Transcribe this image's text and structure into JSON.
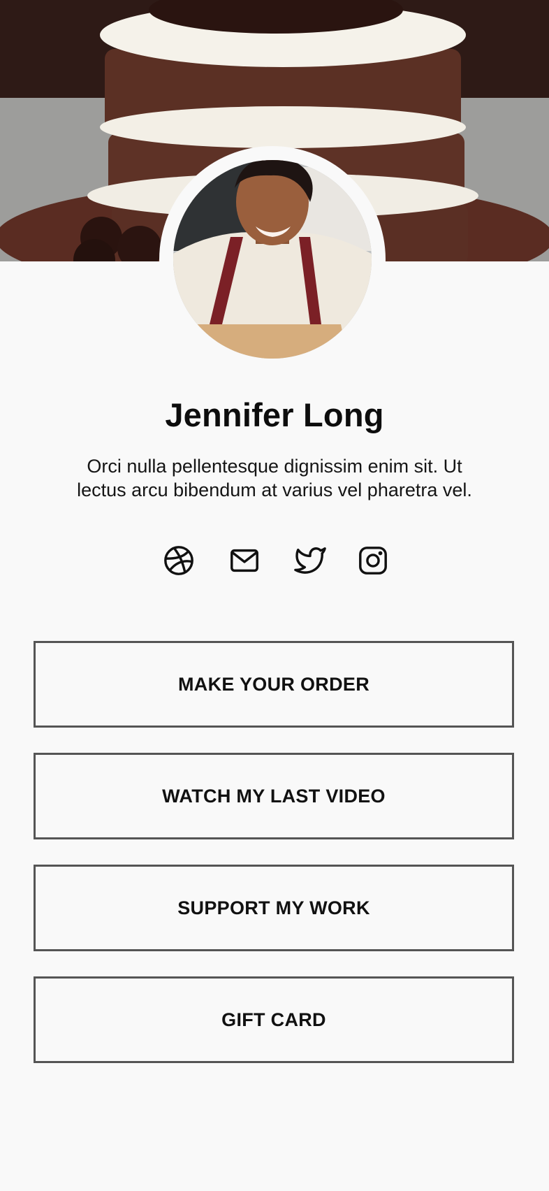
{
  "profile": {
    "name": "Jennifer Long",
    "bio": "Orci nulla pellentesque dignissim enim sit. Ut lectus arcu bibendum at varius vel pharetra vel."
  },
  "socials": [
    {
      "icon": "dribbble-icon"
    },
    {
      "icon": "mail-icon"
    },
    {
      "icon": "twitter-icon"
    },
    {
      "icon": "instagram-icon"
    }
  ],
  "buttons": {
    "order": "MAKE YOUR ORDER",
    "video": "WATCH MY LAST VIDEO",
    "support": "SUPPORT MY WORK",
    "gift": "GIFT CARD"
  },
  "colors": {
    "background": "#f9f9f9",
    "button_border": "#555555",
    "text": "#111111"
  }
}
